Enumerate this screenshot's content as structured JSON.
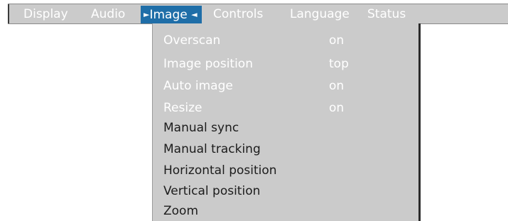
{
  "menubar": {
    "tabs": [
      {
        "label": "Display"
      },
      {
        "label": "Audio"
      },
      {
        "label": "Image",
        "active": true
      },
      {
        "label": "Controls"
      },
      {
        "label": "Language"
      },
      {
        "label": "Status"
      }
    ],
    "active_left_arrow": "►",
    "active_right_arrow": "◄"
  },
  "image_menu": {
    "items": [
      {
        "label": "Overscan",
        "value": "on",
        "enabled": false
      },
      {
        "label": "Image position",
        "value": "top",
        "enabled": false
      },
      {
        "label": "Auto image",
        "value": "on",
        "enabled": false
      },
      {
        "label": "Resize",
        "value": "on",
        "enabled": false
      },
      {
        "label": "Manual sync",
        "value": "",
        "enabled": true
      },
      {
        "label": "Manual tracking",
        "value": "",
        "enabled": true
      },
      {
        "label": "Horizontal position",
        "value": "",
        "enabled": true
      },
      {
        "label": "Vertical position",
        "value": "",
        "enabled": true
      },
      {
        "label": "Zoom",
        "value": "",
        "enabled": true
      }
    ]
  },
  "colors": {
    "menubar_bg": "#cbcbcb",
    "active_tab_bg": "#1f6ea8",
    "enabled_text": "#1c1c1c",
    "disabled_text": "#ffffff"
  }
}
